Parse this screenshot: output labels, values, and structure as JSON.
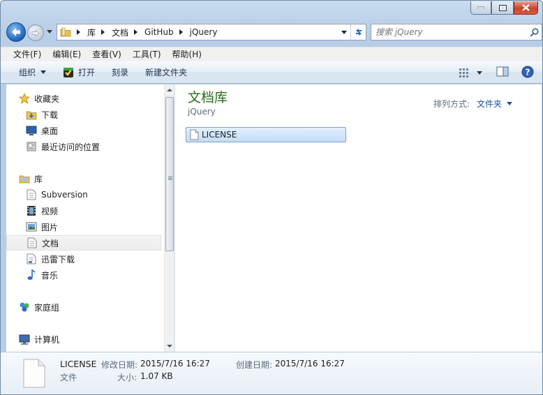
{
  "address": {
    "crumbs": [
      "库",
      "文档",
      "GitHub",
      "jQuery"
    ]
  },
  "search": {
    "placeholder": "搜索 jQuery"
  },
  "menu": [
    "文件(F)",
    "编辑(E)",
    "查看(V)",
    "工具(T)",
    "帮助(H)"
  ],
  "toolbar": {
    "organize": "组织",
    "open": "打开",
    "burn": "刻录",
    "new_folder": "新建文件夹"
  },
  "nav": {
    "favorites": "收藏夹",
    "downloads": "下载",
    "desktop": "桌面",
    "recent": "最近访问的位置",
    "libraries": "库",
    "subversion": "Subversion",
    "videos": "视频",
    "pictures": "图片",
    "documents": "文档",
    "xunlei": "迅雷下载",
    "music": "音乐",
    "homegroup": "家庭组",
    "computer": "计算机"
  },
  "content": {
    "title": "文档库",
    "subtitle": "jQuery",
    "arrange_label": "排列方式:",
    "arrange_value": "文件夹",
    "files": [
      {
        "name": "LICENSE"
      }
    ]
  },
  "details": {
    "name": "LICENSE",
    "type": "文件",
    "modified_label": "修改日期:",
    "modified_value": "2015/7/16 16:27",
    "created_label": "创建日期:",
    "created_value": "2015/7/16 16:27",
    "size_label": "大小:",
    "size_value": "1.07 KB"
  },
  "colors": {
    "library_title": "#2a6d1e",
    "selection_border": "#7da2ce"
  }
}
